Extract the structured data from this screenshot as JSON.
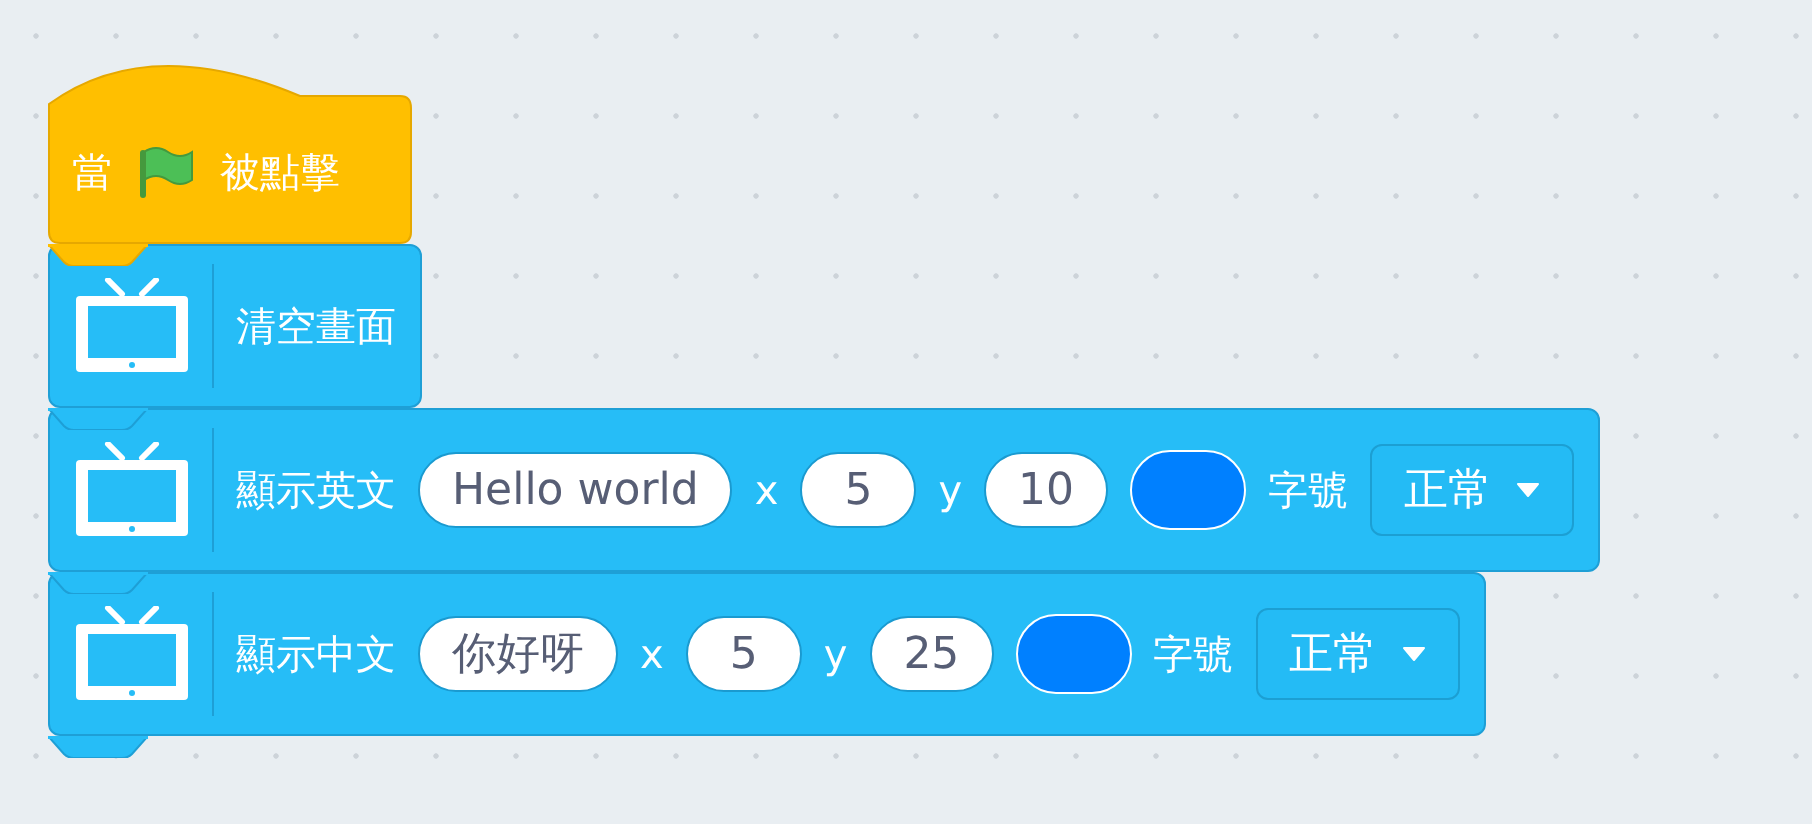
{
  "blocks": [
    {
      "kind": "hat",
      "parts": [
        {
          "kind": "label",
          "text": "當"
        },
        {
          "kind": "flag"
        },
        {
          "kind": "label",
          "text": "被點擊"
        }
      ]
    },
    {
      "kind": "command",
      "parts": [
        {
          "kind": "label",
          "text": "清空畫面"
        }
      ]
    },
    {
      "kind": "command",
      "parts": [
        {
          "kind": "label",
          "text": "顯示英文"
        },
        {
          "kind": "text_input",
          "value": "Hello world"
        },
        {
          "kind": "label",
          "text": "x"
        },
        {
          "kind": "number_input",
          "value": "5"
        },
        {
          "kind": "label",
          "text": "y"
        },
        {
          "kind": "number_input",
          "value": "10"
        },
        {
          "kind": "color_input",
          "color": "#0080ff"
        },
        {
          "kind": "label",
          "text": "字號"
        },
        {
          "kind": "dropdown",
          "value": "正常"
        }
      ]
    },
    {
      "kind": "command",
      "parts": [
        {
          "kind": "label",
          "text": "顯示中文"
        },
        {
          "kind": "text_input",
          "value": "你好呀"
        },
        {
          "kind": "label",
          "text": "x"
        },
        {
          "kind": "number_input",
          "value": "5"
        },
        {
          "kind": "label",
          "text": "y"
        },
        {
          "kind": "number_input",
          "value": "25"
        },
        {
          "kind": "color_input",
          "color": "#0080ff"
        },
        {
          "kind": "label",
          "text": "字號"
        },
        {
          "kind": "dropdown",
          "value": "正常"
        }
      ]
    }
  ]
}
